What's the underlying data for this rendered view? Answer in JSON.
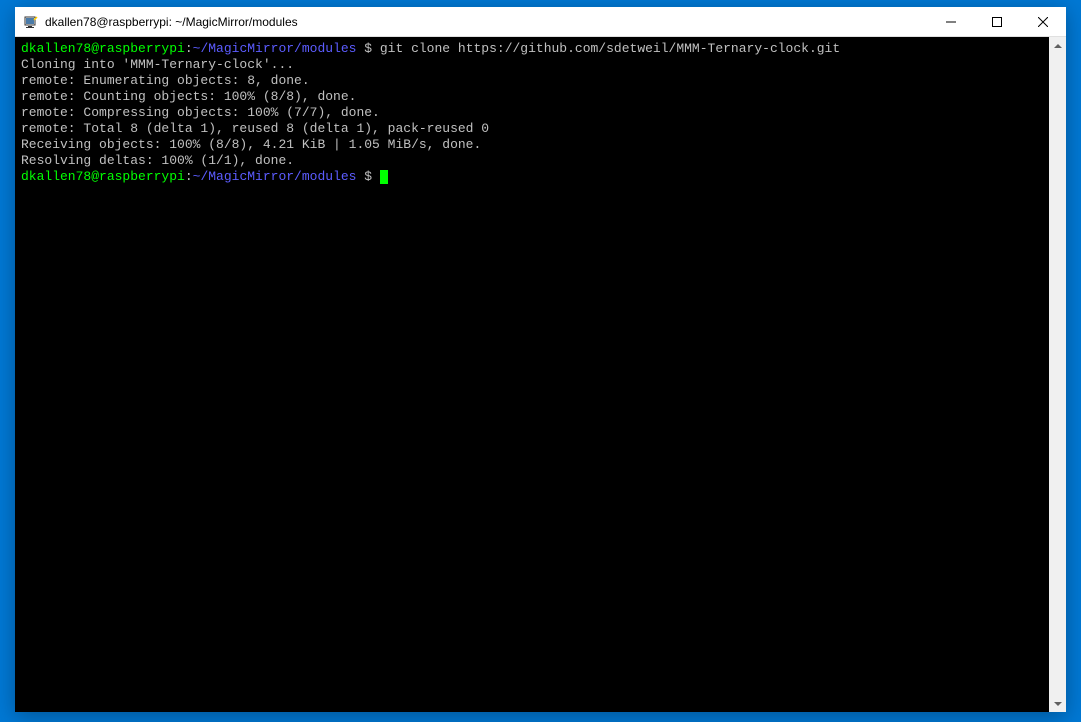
{
  "window": {
    "title": "dkallen78@raspberrypi: ~/MagicMirror/modules"
  },
  "terminal": {
    "prompt1": {
      "user": "dkallen78@raspberrypi",
      "colon": ":",
      "path": "~/MagicMirror/modules",
      "dollar": " $ ",
      "command": "git clone https://github.com/sdetweil/MMM-Ternary-clock.git"
    },
    "output": {
      "line1": "Cloning into 'MMM-Ternary-clock'...",
      "line2": "remote: Enumerating objects: 8, done.",
      "line3": "remote: Counting objects: 100% (8/8), done.",
      "line4": "remote: Compressing objects: 100% (7/7), done.",
      "line5": "remote: Total 8 (delta 1), reused 8 (delta 1), pack-reused 0",
      "line6": "Receiving objects: 100% (8/8), 4.21 KiB | 1.05 MiB/s, done.",
      "line7": "Resolving deltas: 100% (1/1), done."
    },
    "prompt2": {
      "user": "dkallen78@raspberrypi",
      "colon": ":",
      "path": "~/MagicMirror/modules",
      "dollar": " $ "
    }
  }
}
